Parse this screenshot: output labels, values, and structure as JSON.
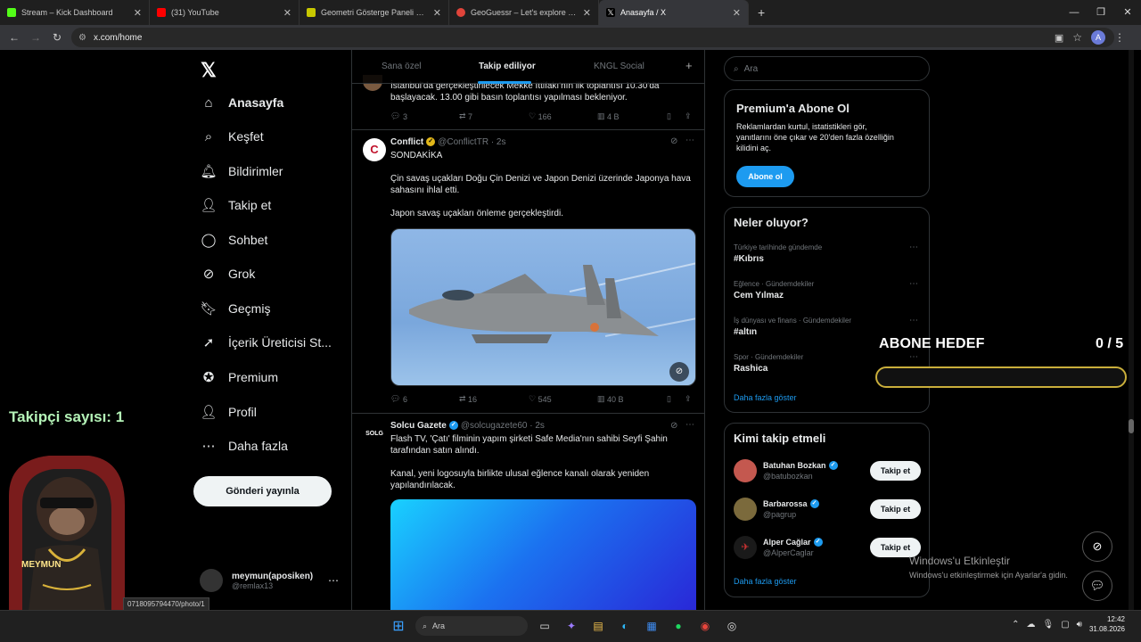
{
  "browser": {
    "tabs": [
      {
        "title": "Stream – Kick Dashboard",
        "color": "#53fc18"
      },
      {
        "title": "(31) YouTube",
        "color": "#ff0000"
      },
      {
        "title": "Geometri Gösterge Paneli Lite",
        "color": "#c8c800"
      },
      {
        "title": "GeoGuessr – Let's explore the w",
        "color": "#e0443a"
      },
      {
        "title": "Anasayfa / X",
        "color": "#ffffff"
      }
    ],
    "url": "x.com/home",
    "profile_initial": "A"
  },
  "sidebar": {
    "items": [
      {
        "label": "Anasayfa",
        "icon": "home-icon"
      },
      {
        "label": "Keşfet",
        "icon": "search-icon"
      },
      {
        "label": "Bildirimler",
        "icon": "bell-icon"
      },
      {
        "label": "Takip et",
        "icon": "add-person-icon"
      },
      {
        "label": "Sohbet",
        "icon": "chat-icon"
      },
      {
        "label": "Grok",
        "icon": "grok-icon"
      },
      {
        "label": "Geçmiş",
        "icon": "bookmark-icon"
      },
      {
        "label": "İçerik Üreticisi St...",
        "icon": "rocket-icon"
      },
      {
        "label": "Premium",
        "icon": "verified-icon"
      },
      {
        "label": "Profil",
        "icon": "person-icon"
      },
      {
        "label": "Daha fazla",
        "icon": "more-circle-icon"
      }
    ],
    "post_button": "Gönderi yayınla",
    "account": {
      "name": "meymun(aposiken)",
      "handle": "@remlax13"
    }
  },
  "feed": {
    "tabs": [
      "Sana özel",
      "Takip ediliyor",
      "KNGL Social"
    ],
    "tweet0": {
      "text1": "İstanbul'da gerçekleştirilecek Mekke İttifakı'nın ilk toplantısı 10.30'da",
      "text2": "başlayacak. 13.00 gibi basın toplantısı yapılması bekleniyor.",
      "replies": "3",
      "retweets": "7",
      "likes": "166",
      "views": "4 B"
    },
    "tweet1": {
      "name": "Conflict",
      "handle": "@ConflictTR · 2s",
      "line1": "SONDAKİKA",
      "line2": "Çin savaş uçakları Doğu Çin Denizi ve Japon Denizi üzerinde Japonya hava",
      "line3": "sahasını ihlal etti.",
      "line4": "Japon savaş uçakları önleme gerçekleştirdi.",
      "replies": "6",
      "retweets": "16",
      "likes": "545",
      "views": "40 B"
    },
    "tweet2": {
      "avatar_text": "SOLG",
      "name": "Solcu Gazete",
      "handle": "@solcugazete60 · 2s",
      "line1": "Flash TV, 'Çatı' filminin yapım şirketi Safe Media'nın sahibi Seyfi Şahin",
      "line2": "tarafından satın alındı.",
      "line3": "Kanal, yeni logosuyla birlikte ulusal eğlence kanalı olarak yeniden",
      "line4": "yapılandırılacak."
    }
  },
  "right": {
    "search_placeholder": "Ara",
    "premium": {
      "title": "Premium'a Abone Ol",
      "body1": "Reklamlardan kurtul, istatistikleri gör,",
      "body2": "yanıtlarını öne çıkar ve 20'den fazla özelliğin",
      "body3": "kilidini aç.",
      "button": "Abone ol"
    },
    "trends": {
      "title": "Neler oluyor?",
      "items": [
        {
          "category": "Türkiye tarihinde gündemde",
          "name": "#Kıbrıs"
        },
        {
          "category": "Eğlence · Gündemdekiler",
          "name": "Cem Yılmaz"
        },
        {
          "category": "İş dünyası ve finans · Gündemdekiler",
          "name": "#altın"
        },
        {
          "category": "Spor · Gündemdekiler",
          "name": "Rashica"
        }
      ],
      "show_more": "Daha fazla göster"
    },
    "who_to_follow": {
      "title": "Kimi takip etmeli",
      "items": [
        {
          "name": "Batuhan Bozkan",
          "handle": "@batubozkan",
          "button": "Takip et"
        },
        {
          "name": "Barbarossa",
          "handle": "@pagrup",
          "button": "Takip et"
        },
        {
          "name": "Alper Cağlar",
          "handle": "@AlperCaglar",
          "button": "Takip et"
        }
      ],
      "show_more": "Daha fazla göster"
    }
  },
  "overlay": {
    "follower_label": "Takipçi sayısı: 1",
    "mascot_label": "MEYMUN",
    "goal_label": "ABONE HEDEF",
    "goal_count": "0 / 5",
    "goal_progress": 0,
    "windows_activate_title": "Windows'u Etkinleştir",
    "windows_activate_body": "Windows'u etkinleştirmek için Ayarlar'a gidin.",
    "status_url": "0718095794470/photo/1"
  },
  "taskbar": {
    "search": "Ara",
    "time": "12:42",
    "date": "31.08.2026"
  }
}
